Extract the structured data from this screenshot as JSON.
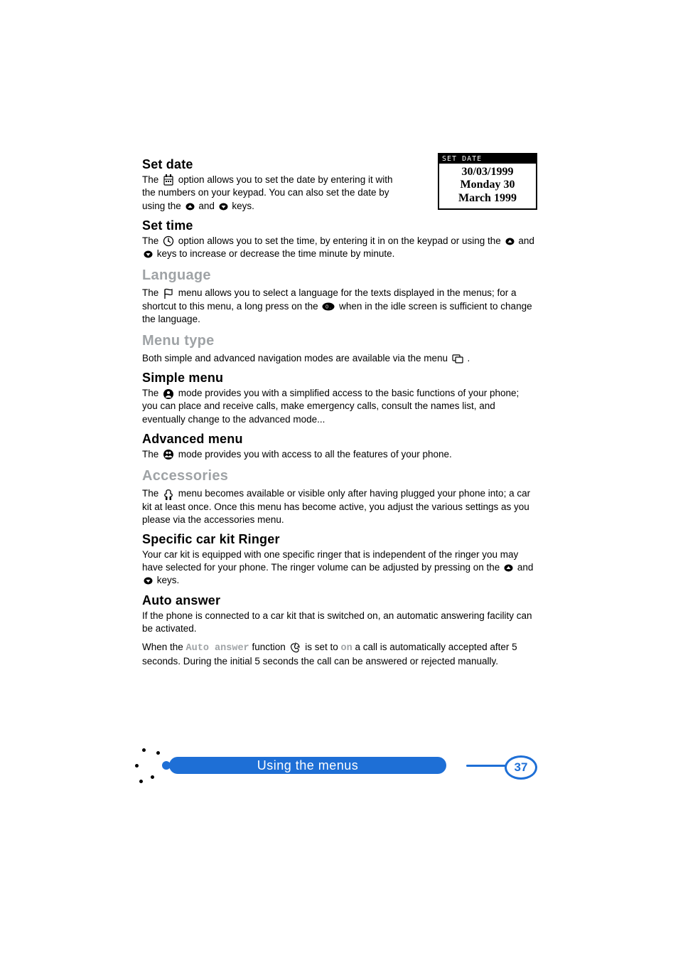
{
  "lcd": {
    "header": "SET DATE",
    "line1": "30/03/1999",
    "line2": "Monday 30",
    "line3": "March 1999"
  },
  "sections": {
    "set_date": {
      "title": "Set date",
      "p1a": "The ",
      "p1b": " option allows you to set the date by entering it with the numbers on your keypad.  You can also set the date by using the ",
      "p1c": " and ",
      "p1d": " keys."
    },
    "set_time": {
      "title": "Set time",
      "p1a": "The ",
      "p1b": " option allows you to set the time, by entering it in on the keypad or using the ",
      "p1c": " and ",
      "p1d": " keys to increase or decrease the time minute by minute."
    },
    "language": {
      "title": "Language",
      "p1a": "The ",
      "p1b": " menu allows you to select a language for the texts displayed in the menus; for a shortcut to this menu, a long press on the ",
      "p1c": " when in the idle screen is sufficient to change the language."
    },
    "menu_type": {
      "title": "Menu type",
      "p1a": "Both simple and advanced navigation modes are available via the menu ",
      "p1b": " ."
    },
    "simple_menu": {
      "title": "Simple menu",
      "p1a": "The ",
      "p1b": " mode provides you with a simplified access to the basic functions of your phone; you can place and receive calls, make emergency calls, consult the names list, and eventually change to the advanced mode..."
    },
    "advanced_menu": {
      "title": "Advanced menu",
      "p1a": "The ",
      "p1b": " mode provides you with access to all the features of your phone."
    },
    "accessories": {
      "title": "Accessories",
      "p1a": "The ",
      "p1b": " menu becomes available or visible only after having plugged your phone into; a car kit at least once.  Once this menu has become active, you adjust the various settings as you please via the accessories menu."
    },
    "car_kit_ringer": {
      "title": "Specific car kit Ringer",
      "p1a": "Your car kit is equipped with one specific ringer that is independent of the ringer you may have selected for your phone.  The ringer volume can be adjusted by pressing on the ",
      "p1b": " and ",
      "p1c": " keys."
    },
    "auto_answer": {
      "title": "Auto answer",
      "p1": "If the phone is connected to a car kit that is switched on, an automatic answering facility can be activated.",
      "p2a": "When the ",
      "p2_fn": "Auto answer",
      "p2b": " function ",
      "p2c": " is set to ",
      "p2_on": "on",
      "p2d": " a call is automatically accepted after 5 seconds.  During the initial 5 seconds the call can be answered or rejected manually."
    }
  },
  "footer": {
    "title": "Using the menus",
    "page": "37"
  }
}
